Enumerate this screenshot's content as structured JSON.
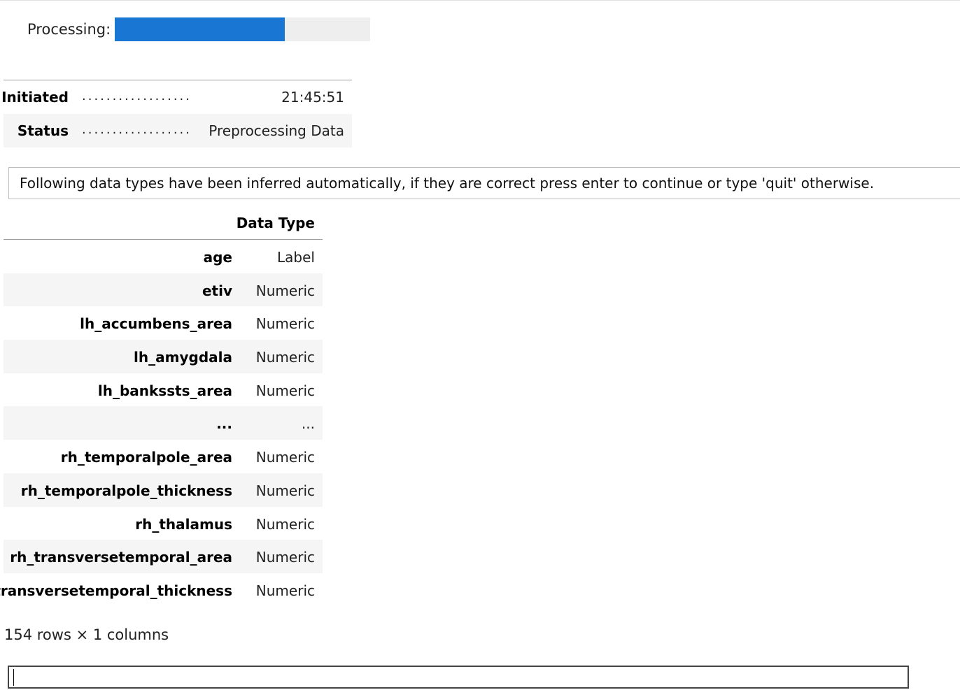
{
  "progress": {
    "label": "Processing:",
    "fraction": 0.666,
    "color": "#1976d2",
    "track_color": "#eeeeee"
  },
  "info": {
    "rows": [
      {
        "key": "Initiated",
        "dots": "..................",
        "value": "21:45:51"
      },
      {
        "key": "Status",
        "dots": "..................",
        "value": "Preprocessing Data"
      }
    ]
  },
  "message": "Following data types have been inferred automatically, if they are correct press enter to continue or type 'quit' otherwise.",
  "datatypes": {
    "header": "Data Type",
    "rows": [
      {
        "name": "age",
        "type": "Label"
      },
      {
        "name": "etiv",
        "type": "Numeric"
      },
      {
        "name": "lh_accumbens_area",
        "type": "Numeric"
      },
      {
        "name": "lh_amygdala",
        "type": "Numeric"
      },
      {
        "name": "lh_bankssts_area",
        "type": "Numeric"
      },
      {
        "name": "...",
        "type": "..."
      },
      {
        "name": "rh_temporalpole_area",
        "type": "Numeric"
      },
      {
        "name": "rh_temporalpole_thickness",
        "type": "Numeric"
      },
      {
        "name": "rh_thalamus",
        "type": "Numeric"
      },
      {
        "name": "rh_transversetemporal_area",
        "type": "Numeric"
      },
      {
        "name": "rh_transversetemporal_thickness",
        "type": "Numeric"
      }
    ]
  },
  "row_count": "154 rows × 1 columns",
  "input": {
    "value": ""
  }
}
